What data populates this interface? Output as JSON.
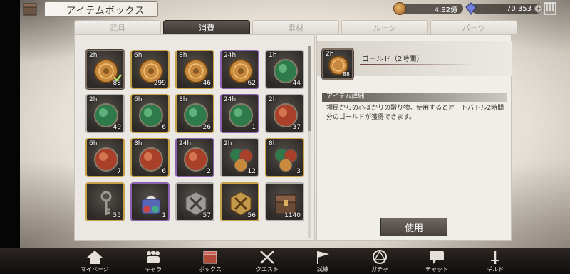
{
  "header": {
    "title": "アイテムボックス",
    "gold_amount": "4.82億",
    "gem_amount": "70,353"
  },
  "tabs": [
    {
      "label": "武具",
      "active": false
    },
    {
      "label": "消費",
      "active": true
    },
    {
      "label": "素材",
      "active": false
    },
    {
      "label": "ルーン",
      "active": false
    },
    {
      "label": "パーツ",
      "active": false
    }
  ],
  "items": [
    {
      "duration": "2h",
      "count": "88",
      "icon": "gold-coin-icon",
      "frame": "selected"
    },
    {
      "duration": "6h",
      "count": "299",
      "icon": "gold-coin-icon",
      "frame": "gold"
    },
    {
      "duration": "8h",
      "count": "46",
      "icon": "gold-coin-icon",
      "frame": "gold"
    },
    {
      "duration": "24h",
      "count": "62",
      "icon": "gold-coin-icon",
      "frame": "purple"
    },
    {
      "duration": "1h",
      "count": "44",
      "icon": "green-orb-icon",
      "frame": "silver"
    },
    {
      "duration": "2h",
      "count": "49",
      "icon": "green-orb-icon",
      "frame": "silver"
    },
    {
      "duration": "6h",
      "count": "6",
      "icon": "green-orb-icon",
      "frame": "gold"
    },
    {
      "duration": "8h",
      "count": "26",
      "icon": "green-orb-icon",
      "frame": "gold"
    },
    {
      "duration": "24h",
      "count": "1",
      "icon": "green-orb-icon",
      "frame": "purple"
    },
    {
      "duration": "2h",
      "count": "37",
      "icon": "red-orb-icon",
      "frame": "silver"
    },
    {
      "duration": "6h",
      "count": "7",
      "icon": "red-orb-icon",
      "frame": "gold"
    },
    {
      "duration": "8h",
      "count": "6",
      "icon": "red-orb-icon",
      "frame": "gold"
    },
    {
      "duration": "24h",
      "count": "2",
      "icon": "red-orb-icon",
      "frame": "purple"
    },
    {
      "duration": "2h",
      "count": "12",
      "icon": "mixed-orbs-icon",
      "frame": "silver"
    },
    {
      "duration": "8h",
      "count": "3",
      "icon": "mixed-orbs-icon",
      "frame": "gold"
    },
    {
      "duration": "",
      "count": "55",
      "icon": "key-icon",
      "frame": "gold"
    },
    {
      "duration": "",
      "count": "1",
      "icon": "gift-bag-icon",
      "frame": "purple"
    },
    {
      "duration": "",
      "count": "57",
      "icon": "silver-rune-icon",
      "frame": "silver"
    },
    {
      "duration": "",
      "count": "56",
      "icon": "gold-rune-icon",
      "frame": "gold"
    },
    {
      "duration": "",
      "count": "1140",
      "icon": "treasure-chest-icon",
      "frame": "silver"
    }
  ],
  "detail": {
    "duration": "2h",
    "count": "88",
    "name": "ゴールド（2時間）",
    "section_label": "アイテム詳細",
    "description": "領民からの心ばかりの贈り物。使用するとオートバトル2時間分のゴールドが獲得できます。",
    "use_button": "使用"
  },
  "nav": [
    {
      "label": "マイページ",
      "icon": "home-icon"
    },
    {
      "label": "キャラ",
      "icon": "characters-icon"
    },
    {
      "label": "ボックス",
      "icon": "box-icon"
    },
    {
      "label": "クエスト",
      "icon": "crossed-swords-icon"
    },
    {
      "label": "試練",
      "icon": "flag-icon"
    },
    {
      "label": "ガチャ",
      "icon": "magic-circle-icon"
    },
    {
      "label": "チャット",
      "icon": "chat-icon"
    },
    {
      "label": "ギルド",
      "icon": "guild-sword-icon"
    }
  ],
  "colors": {
    "gold_frame": "#c6a14a",
    "purple_frame": "#8b63b0",
    "silver_frame": "#b3b1ad",
    "active_tab": "#4a433e"
  }
}
